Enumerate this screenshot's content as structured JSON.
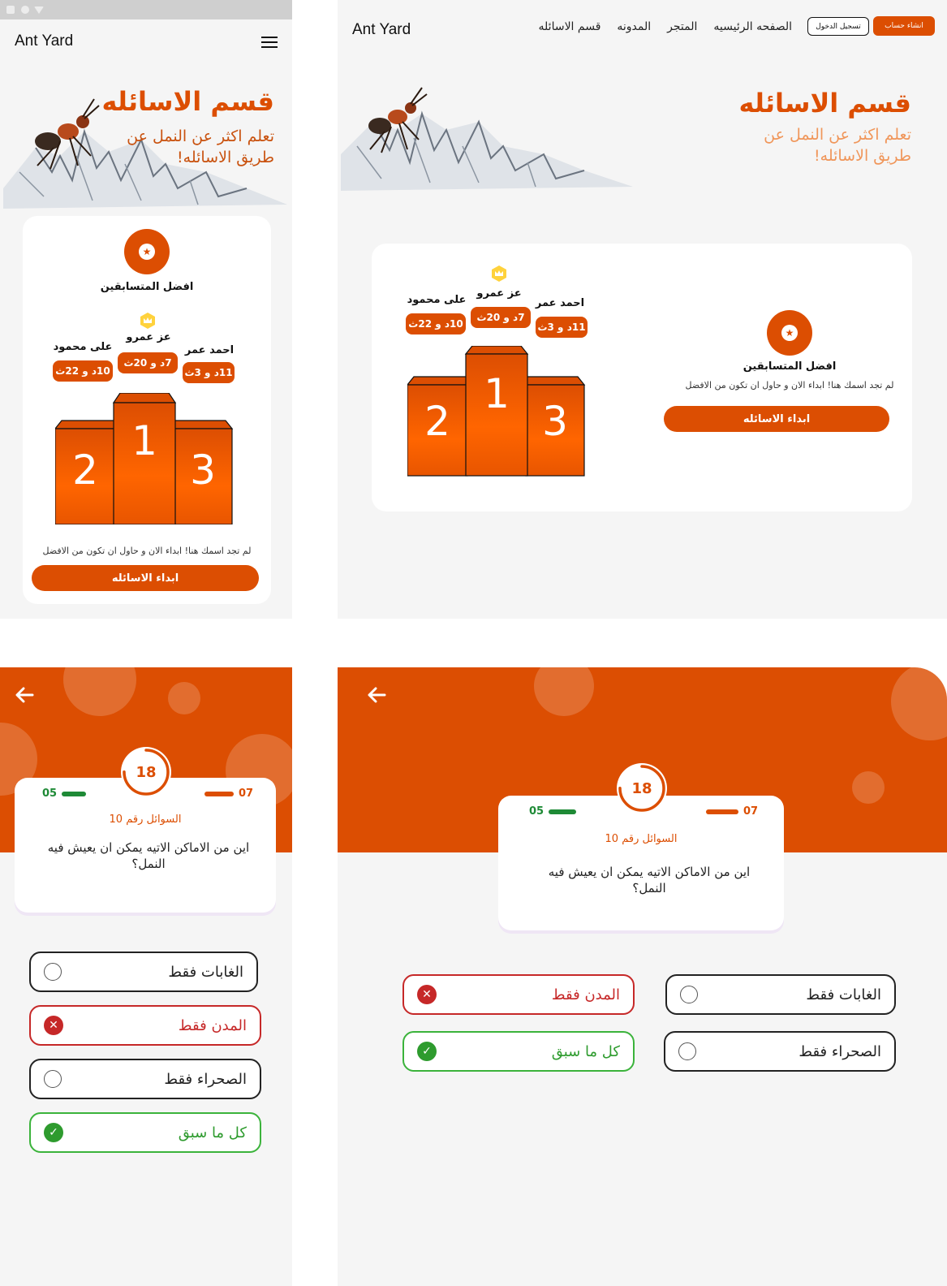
{
  "brand": {
    "name": "Ant Yard",
    "accent": "#dc4e02",
    "accent_light": "#f0965a",
    "gold": "#ffd23c",
    "wrong": "#c62828",
    "right": "#2e9b2e"
  },
  "nav": {
    "items": [
      "الصفحه الرئيسيه",
      "المتجر",
      "المدونه",
      "قسم الاسائله"
    ],
    "login": "تسجيل الدخول",
    "signup": "انشاء حساب"
  },
  "hero": {
    "title": "قسم الاسائله",
    "subtitle_line1": "تعلم اكثر عن النمل عن",
    "subtitle_line2": "طريق الاسائله!"
  },
  "leaderboard": {
    "heading": "افضل المتسابقين",
    "hint": "لم تجد اسمك هنا! ابداء الان و حاول ان تكون من الافضل",
    "cta": "ابداء الاسائله",
    "first": {
      "name": "عز عمرو",
      "time": "7د و 20ث",
      "rank": "1"
    },
    "second": {
      "name": "على محمود",
      "time": "10د و 22ث",
      "rank": "2"
    },
    "third": {
      "name": "احمد عمر",
      "time": "11د و 3ث",
      "rank": "3"
    }
  },
  "quiz": {
    "timer": "18",
    "timer_progress": 0.75,
    "score_correct": "05",
    "score_wrong": "07",
    "label": "السوائل رقم 10",
    "question": "اين من الاماكن الاتيه يمكن ان يعيش فيه النمل؟",
    "options": {
      "forests": "الغابات فقط",
      "cities": "المدن فقط",
      "desert": "الصحراء فقط",
      "all": "كل ما سبق"
    },
    "wrong_option": "cities",
    "correct_option": "all"
  },
  "icons": {
    "menu": "hamburger-icon",
    "star": "star-icon",
    "crown": "crown-icon",
    "back": "arrow-left-icon",
    "wrong": "x-icon",
    "right": "check-icon"
  }
}
